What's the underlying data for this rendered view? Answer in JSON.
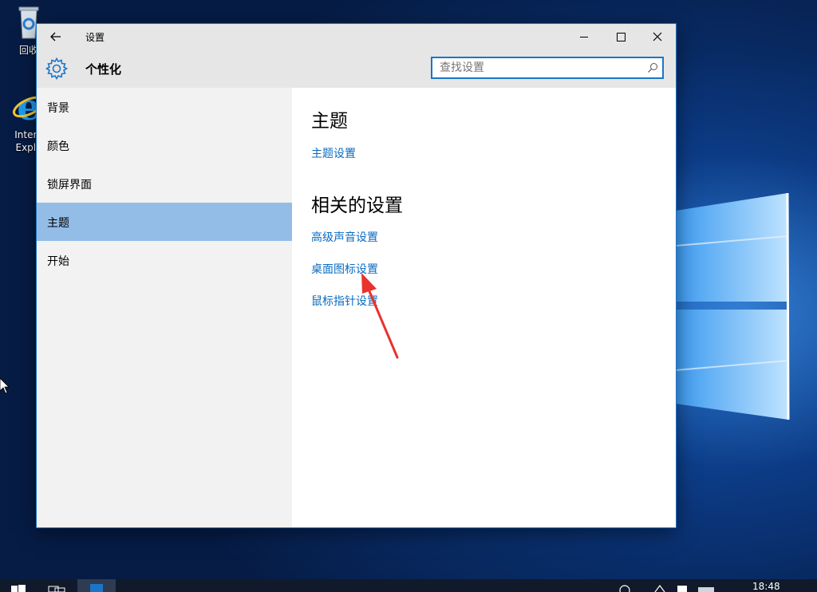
{
  "desktop": {
    "icons": [
      {
        "name": "recycle-bin",
        "label": "回收"
      },
      {
        "name": "internet-explorer",
        "label_line1": "Intern",
        "label_line2": "Explo"
      }
    ]
  },
  "window": {
    "title": "设置",
    "page_title": "个性化",
    "search": {
      "placeholder": "查找设置",
      "value": ""
    },
    "controls": {
      "minimize": "minimize-icon",
      "maximize": "maximize-icon",
      "close": "close-icon"
    }
  },
  "sidebar": {
    "items": [
      {
        "label": "背景",
        "active": false
      },
      {
        "label": "颜色",
        "active": false
      },
      {
        "label": "锁屏界面",
        "active": false
      },
      {
        "label": "主题",
        "active": true
      },
      {
        "label": "开始",
        "active": false
      }
    ]
  },
  "content": {
    "section1": {
      "heading": "主题",
      "links": [
        "主题设置"
      ]
    },
    "section2": {
      "heading": "相关的设置",
      "links": [
        "高级声音设置",
        "桌面图标设置",
        "鼠标指针设置"
      ]
    }
  },
  "taskbar": {
    "clock": "18:48"
  },
  "colors": {
    "accent": "#1b76c7",
    "link": "#0a6bc1",
    "active_nav": "#93bde7",
    "sidebar_bg": "#f2f2f2",
    "titlebar_bg": "#e6e6e6",
    "annotation_arrow": "#e8322f"
  }
}
